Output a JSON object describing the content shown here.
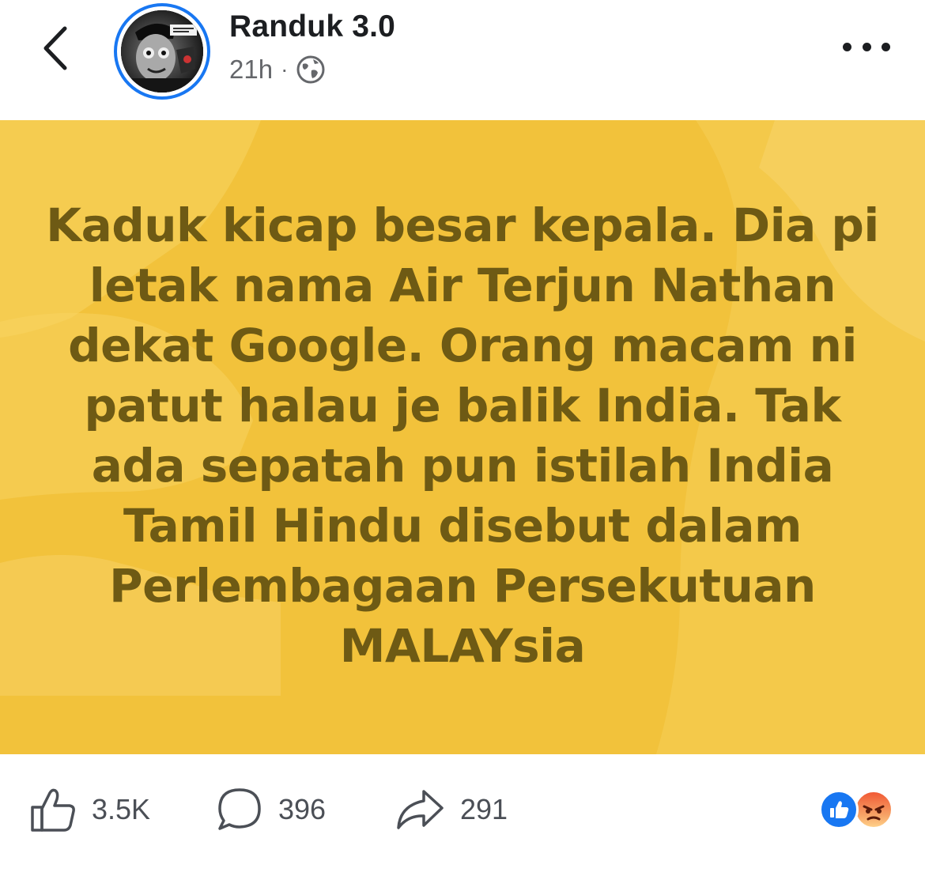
{
  "header": {
    "page_name": "Randuk 3.0",
    "time": "21h",
    "separator": "·",
    "icons": {
      "back": "chevron-left-icon",
      "audience": "globe-icon",
      "more": "more-horizontal-icon"
    }
  },
  "post": {
    "text": "Kaduk kicap besar kepala. Dia pi letak nama Air Terjun Nathan dekat Google. Orang macam ni patut halau je balik India. Tak ada sepatah pun istilah India Tamil Hindu disebut dalam Perlembagaan Persekutuan MALAYsia",
    "background_color": "#f2c23b",
    "text_color": "#6e5a14"
  },
  "actions": {
    "likes": "3.5K",
    "comments": "396",
    "shares": "291",
    "icons": {
      "like": "thumbs-up-icon",
      "comment": "comment-bubble-icon",
      "share": "share-arrow-icon"
    },
    "reactions": [
      "like-reaction-icon",
      "angry-reaction-icon"
    ]
  },
  "colors": {
    "accent": "#1877f2",
    "meta_text": "#65676b"
  }
}
